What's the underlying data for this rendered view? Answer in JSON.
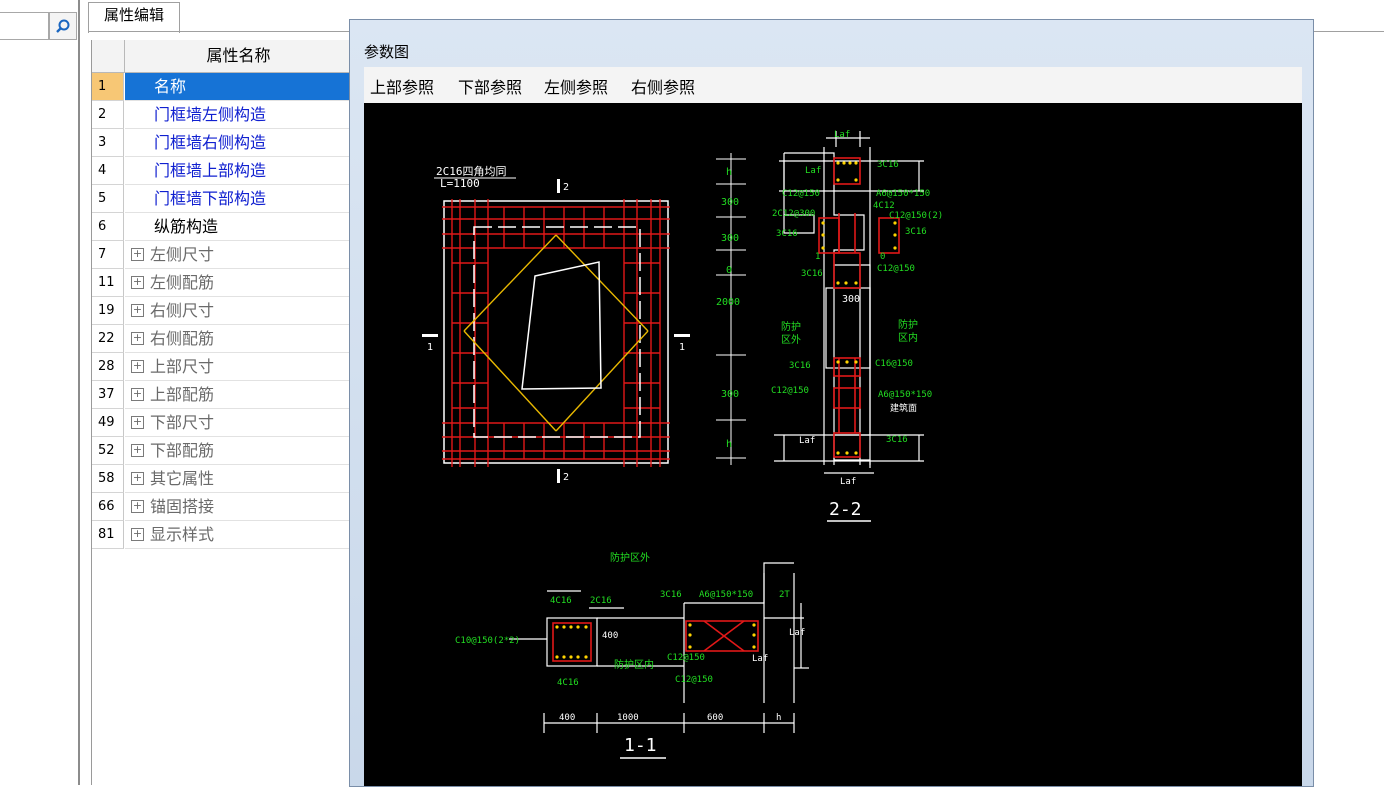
{
  "search": {
    "icon": "search-icon"
  },
  "tabs": [
    {
      "label": "属性编辑"
    }
  ],
  "grid": {
    "header": "属性名称",
    "rows": [
      {
        "num": "1",
        "label": "名称"
      },
      {
        "num": "2",
        "label": "门框墙左侧构造"
      },
      {
        "num": "3",
        "label": "门框墙右侧构造"
      },
      {
        "num": "4",
        "label": "门框墙上部构造"
      },
      {
        "num": "5",
        "label": "门框墙下部构造"
      },
      {
        "num": "6",
        "label": "纵筋构造"
      },
      {
        "num": "7",
        "label": "左侧尺寸"
      },
      {
        "num": "11",
        "label": "左侧配筋"
      },
      {
        "num": "19",
        "label": "右侧尺寸"
      },
      {
        "num": "22",
        "label": "右侧配筋"
      },
      {
        "num": "28",
        "label": "上部尺寸"
      },
      {
        "num": "37",
        "label": "上部配筋"
      },
      {
        "num": "49",
        "label": "下部尺寸"
      },
      {
        "num": "52",
        "label": "下部配筋"
      },
      {
        "num": "58",
        "label": "其它属性"
      },
      {
        "num": "66",
        "label": "锚固搭接"
      },
      {
        "num": "81",
        "label": "显示样式"
      }
    ],
    "expand_symbol": "+"
  },
  "dialog": {
    "title": "参数图",
    "menu": [
      "上部参照",
      "下部参照",
      "左侧参照",
      "右侧参照"
    ]
  },
  "drawing": {
    "elevation": {
      "note1": "2C16四角均同",
      "note2": "L=1100",
      "cut1": "1",
      "cut2": "2"
    },
    "section22": {
      "dims": [
        "h",
        "300",
        "300",
        "0",
        "2000",
        "300",
        "h"
      ],
      "labels": [
        "Laf",
        "Laf",
        "3C16",
        "C12@150",
        "A6@150*150",
        "2C12@300",
        "4C12",
        "C12@150(2)",
        "3C16",
        "3C16",
        "1",
        "0",
        "3C16",
        "C12@150",
        "300",
        "防护",
        "区外",
        "防护",
        "区内",
        "3C16",
        "C16@150",
        "C12@150",
        "A6@150*150",
        "建筑面",
        "Laf",
        "3C16",
        "Laf"
      ],
      "title": "2-2"
    },
    "section11": {
      "labels": [
        "防护区外",
        "4C16",
        "2C16",
        "3C16",
        "A6@150*150",
        "2T",
        "C10@150(2*2)",
        "400",
        "防护区内",
        "C12@150",
        "C12@150",
        "Laf",
        "Laf",
        "4C16"
      ],
      "dims": [
        "400",
        "1000",
        "600",
        "h"
      ],
      "title": "1-1"
    }
  }
}
